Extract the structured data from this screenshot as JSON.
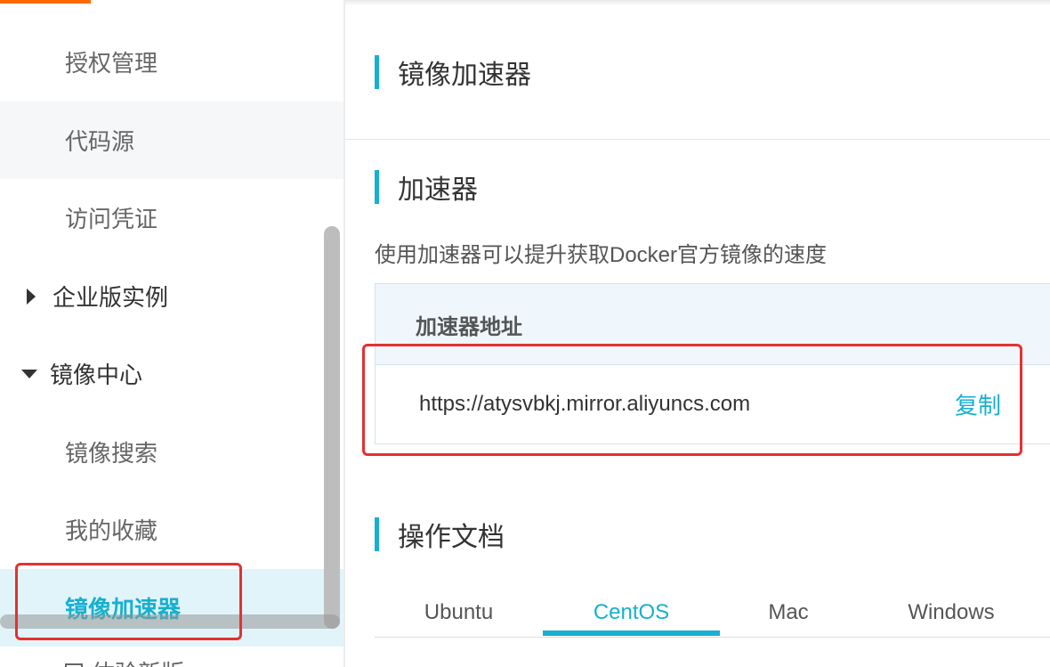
{
  "sidebar": {
    "items": [
      {
        "label": "授权管理",
        "kind": "sub"
      },
      {
        "label": "代码源",
        "kind": "sub"
      },
      {
        "label": "访问凭证",
        "kind": "sub"
      },
      {
        "label": "企业版实例",
        "kind": "group",
        "expanded": false
      },
      {
        "label": "镜像中心",
        "kind": "group",
        "expanded": true
      },
      {
        "label": "镜像搜索",
        "kind": "sub"
      },
      {
        "label": "我的收藏",
        "kind": "sub"
      },
      {
        "label": "镜像加速器",
        "kind": "sub",
        "active": true
      }
    ],
    "bottom_item_label": "体验新版"
  },
  "main": {
    "page_title": "镜像加速器",
    "accelerator_title": "加速器",
    "description": "使用加速器可以提升获取Docker官方镜像的速度",
    "address_header": "加速器地址",
    "address_url": "https://atysvbkj.mirror.aliyuncs.com",
    "copy_label": "复制",
    "docs_title": "操作文档",
    "tabs": [
      {
        "label": "Ubuntu"
      },
      {
        "label": "CentOS",
        "active": true
      },
      {
        "label": "Mac"
      },
      {
        "label": "Windows"
      }
    ]
  },
  "colors": {
    "accent": "#17b0cf",
    "brand_orange": "#ff6a00",
    "annotation_red": "#e53030"
  }
}
